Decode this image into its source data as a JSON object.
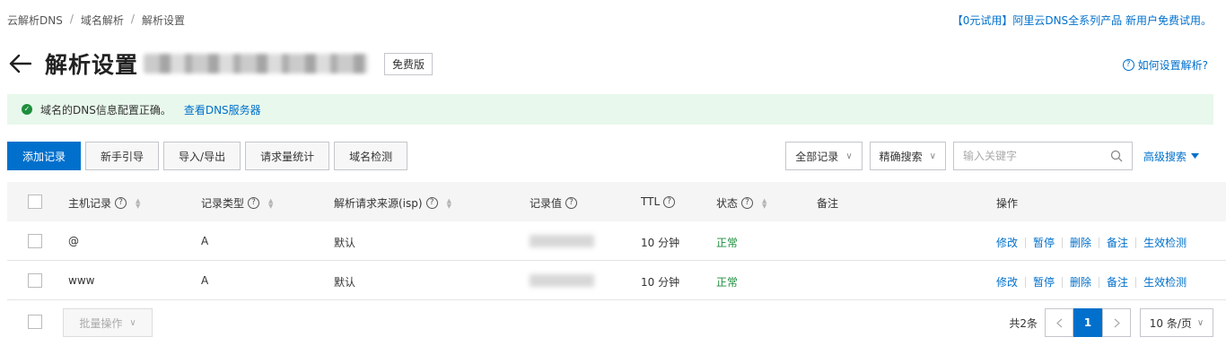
{
  "breadcrumb": [
    "云解析DNS",
    "域名解析",
    "解析设置"
  ],
  "promo": "【0元试用】阿里云DNS全系列产品 新用户免费试用。",
  "title": "解析设置",
  "edition_badge": "免费版",
  "help_link": "如何设置解析?",
  "alert": {
    "text": "域名的DNS信息配置正确。",
    "link": "查看DNS服务器"
  },
  "toolbar": [
    "添加记录",
    "新手引导",
    "导入/导出",
    "请求量统计",
    "域名检测"
  ],
  "filter": {
    "scope": "全部记录",
    "mode": "精确搜索",
    "search_placeholder": "输入关键字",
    "advanced": "高级搜索"
  },
  "columns": {
    "host": "主机记录",
    "type": "记录类型",
    "isp": "解析请求来源(isp)",
    "value": "记录值",
    "ttl": "TTL",
    "status": "状态",
    "remark": "备注",
    "ops": "操作"
  },
  "rows": [
    {
      "host": "@",
      "type": "A",
      "isp": "默认",
      "ttl": "10 分钟",
      "status": "正常"
    },
    {
      "host": "www",
      "type": "A",
      "isp": "默认",
      "ttl": "10 分钟",
      "status": "正常"
    }
  ],
  "row_actions": [
    "修改",
    "暂停",
    "删除",
    "备注",
    "生效检测"
  ],
  "footer": {
    "batch": "批量操作",
    "total": "共2条",
    "page": "1",
    "page_size": "10 条/页"
  },
  "colors": {
    "accent": "#0070cc",
    "success": "#1e8e3e",
    "alert_bg": "#e8f8ec"
  }
}
